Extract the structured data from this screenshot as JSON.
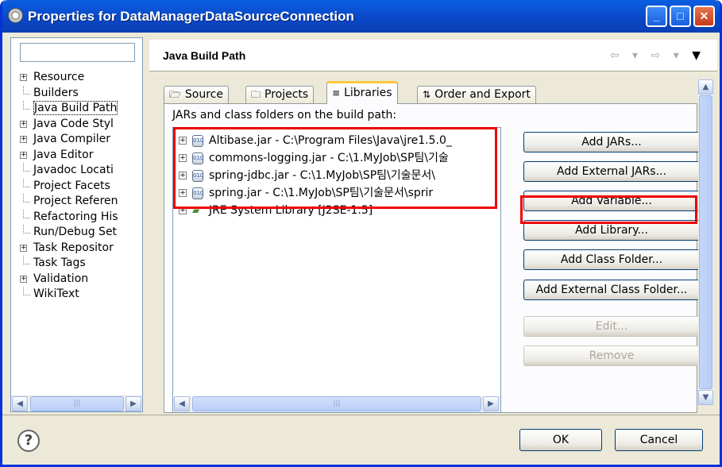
{
  "window": {
    "title": "Properties for DataManagerDataSourceConnection",
    "min": "_",
    "max": "□",
    "close": "✕"
  },
  "filter": {
    "value": ""
  },
  "tree": [
    {
      "label": "Resource",
      "expandable": true
    },
    {
      "label": "Builders",
      "expandable": false
    },
    {
      "label": "Java Build Path",
      "expandable": false,
      "selected": true
    },
    {
      "label": "Java Code Styl",
      "expandable": true
    },
    {
      "label": "Java Compiler",
      "expandable": true
    },
    {
      "label": "Java Editor",
      "expandable": true
    },
    {
      "label": "Javadoc Locati",
      "expandable": false
    },
    {
      "label": "Project Facets",
      "expandable": false
    },
    {
      "label": "Project Referen",
      "expandable": false
    },
    {
      "label": "Refactoring His",
      "expandable": false
    },
    {
      "label": "Run/Debug Set",
      "expandable": false
    },
    {
      "label": "Task Repositor",
      "expandable": true
    },
    {
      "label": "Task Tags",
      "expandable": false
    },
    {
      "label": "Validation",
      "expandable": true
    },
    {
      "label": "WikiText",
      "expandable": false
    }
  ],
  "page": {
    "title": "Java Build Path",
    "back": "⇦ ▾",
    "fwd": "⇨ ▾",
    "menu": "▼"
  },
  "tabs": [
    {
      "label": "Source",
      "icon": "🗁"
    },
    {
      "label": "Projects",
      "icon": "🗀"
    },
    {
      "label": "Libraries",
      "icon": "≡"
    },
    {
      "label": "Order and Export",
      "icon": "⇅"
    }
  ],
  "libs_label": "JARs and class folders on the build path:",
  "libs": [
    {
      "label": "Altibase.jar - C:\\Program Files\\Java\\jre1.5.0_",
      "kind": "jar"
    },
    {
      "label": "commons-logging.jar - C:\\1.MyJob\\SP팀\\기술",
      "kind": "jar"
    },
    {
      "label": "spring-jdbc.jar - C:\\1.MyJob\\SP팀\\기술문서\\",
      "kind": "jar"
    },
    {
      "label": "spring.jar - C:\\1.MyJob\\SP팀\\기술문서\\sprir",
      "kind": "jar"
    },
    {
      "label": "JRE System Library [J2SE-1.5]",
      "kind": "jre"
    }
  ],
  "jar_icon_text": "010",
  "buttons": [
    {
      "label": "Add JARs...",
      "enabled": true
    },
    {
      "label": "Add External JARs...",
      "enabled": true
    },
    {
      "label": "Add Variable...",
      "enabled": true
    },
    {
      "label": "Add Library...",
      "enabled": true
    },
    {
      "label": "Add Class Folder...",
      "enabled": true
    },
    {
      "label": "Add External Class Folder...",
      "enabled": true
    },
    {
      "label": "Edit...",
      "enabled": false
    },
    {
      "label": "Remove",
      "enabled": false
    }
  ],
  "footer": {
    "help": "?",
    "ok": "OK",
    "cancel": "Cancel"
  }
}
